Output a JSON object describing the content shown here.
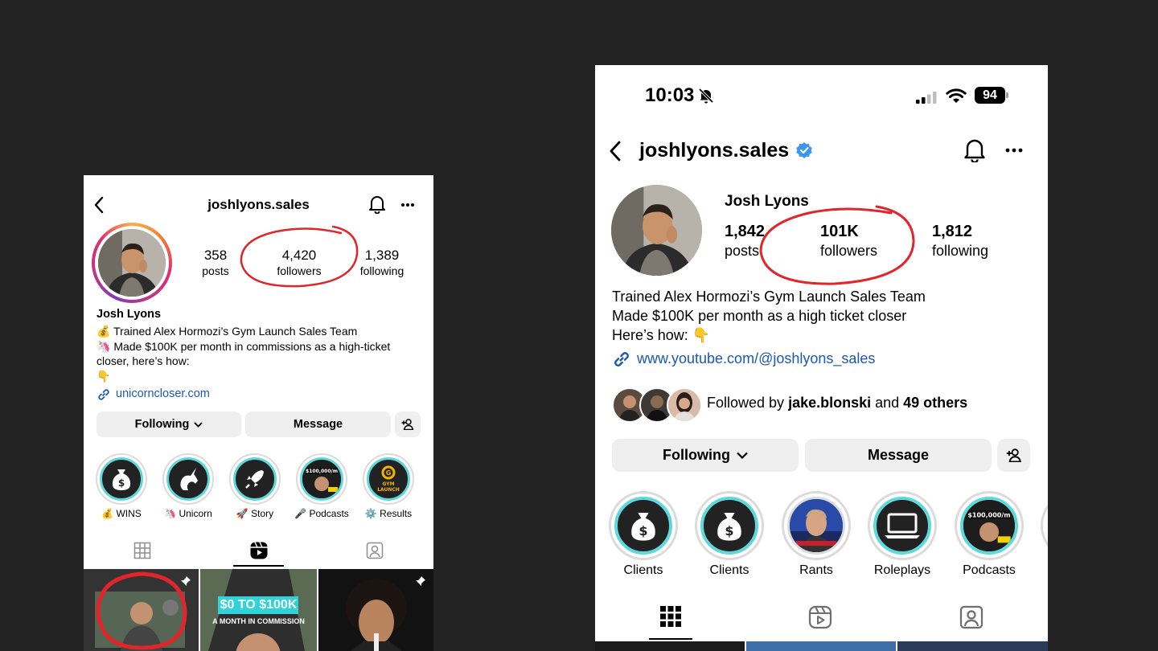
{
  "left": {
    "header": {
      "username": "joshlyons.sales"
    },
    "stats": [
      {
        "value": "358",
        "label": "posts"
      },
      {
        "value": "4,420",
        "label": "followers"
      },
      {
        "value": "1,389",
        "label": "following"
      }
    ],
    "name": "Josh Lyons",
    "bio": [
      "💰 Trained Alex Hormozi’s Gym Launch Sales Team",
      "🦄 Made $100K per month in commissions as a high-ticket",
      "closer, here’s how:",
      "👇"
    ],
    "link": "unicorncloser.com",
    "buttons": {
      "following": "Following",
      "message": "Message"
    },
    "highlights": [
      {
        "label": "💰 WINS",
        "inner": "$"
      },
      {
        "label": "🦄 Unicorn",
        "inner": "🦄"
      },
      {
        "label": "🚀 Story",
        "inner": "🚀"
      },
      {
        "label": "🎤 Podcasts",
        "inner": "$100,000/m"
      },
      {
        "label": "⚙️ Results",
        "inner": "GYM LAUNCH"
      }
    ],
    "thumbs": {
      "banner": "$0 TO $100K",
      "sub": "A MONTH IN COMMISSION"
    },
    "colors": {
      "circle": "#e0262a",
      "link": "#1d58b0"
    }
  },
  "right": {
    "status": {
      "time": "10:03",
      "battery": "94"
    },
    "header": {
      "username": "joshlyons.sales"
    },
    "name": "Josh Lyons",
    "stats": [
      {
        "value": "1,842",
        "label": "posts"
      },
      {
        "value": "101K",
        "label": "followers"
      },
      {
        "value": "1,812",
        "label": "following"
      }
    ],
    "bio": [
      "Trained Alex Hormozi’s Gym Launch Sales Team",
      "Made $100K per month as a high ticket closer",
      "Here’s how:  👇"
    ],
    "link": "www.youtube.com/@joshlyons_sales",
    "followed_by": {
      "prefix": "Followed by ",
      "user": "jake.blonski",
      "middle": " and ",
      "others": "49 others"
    },
    "buttons": {
      "following": "Following",
      "message": "Message"
    },
    "highlights": [
      {
        "label": "Clients",
        "inner": "$"
      },
      {
        "label": "Clients",
        "inner": "$"
      },
      {
        "label": "Rants",
        "inner": ""
      },
      {
        "label": "Roleplays",
        "inner": ""
      },
      {
        "label": "Podcasts",
        "inner": "$100,000/m"
      }
    ],
    "colors": {
      "verified": "#3897f0",
      "link": "#1d58b0",
      "circle": "#e0262a"
    }
  }
}
